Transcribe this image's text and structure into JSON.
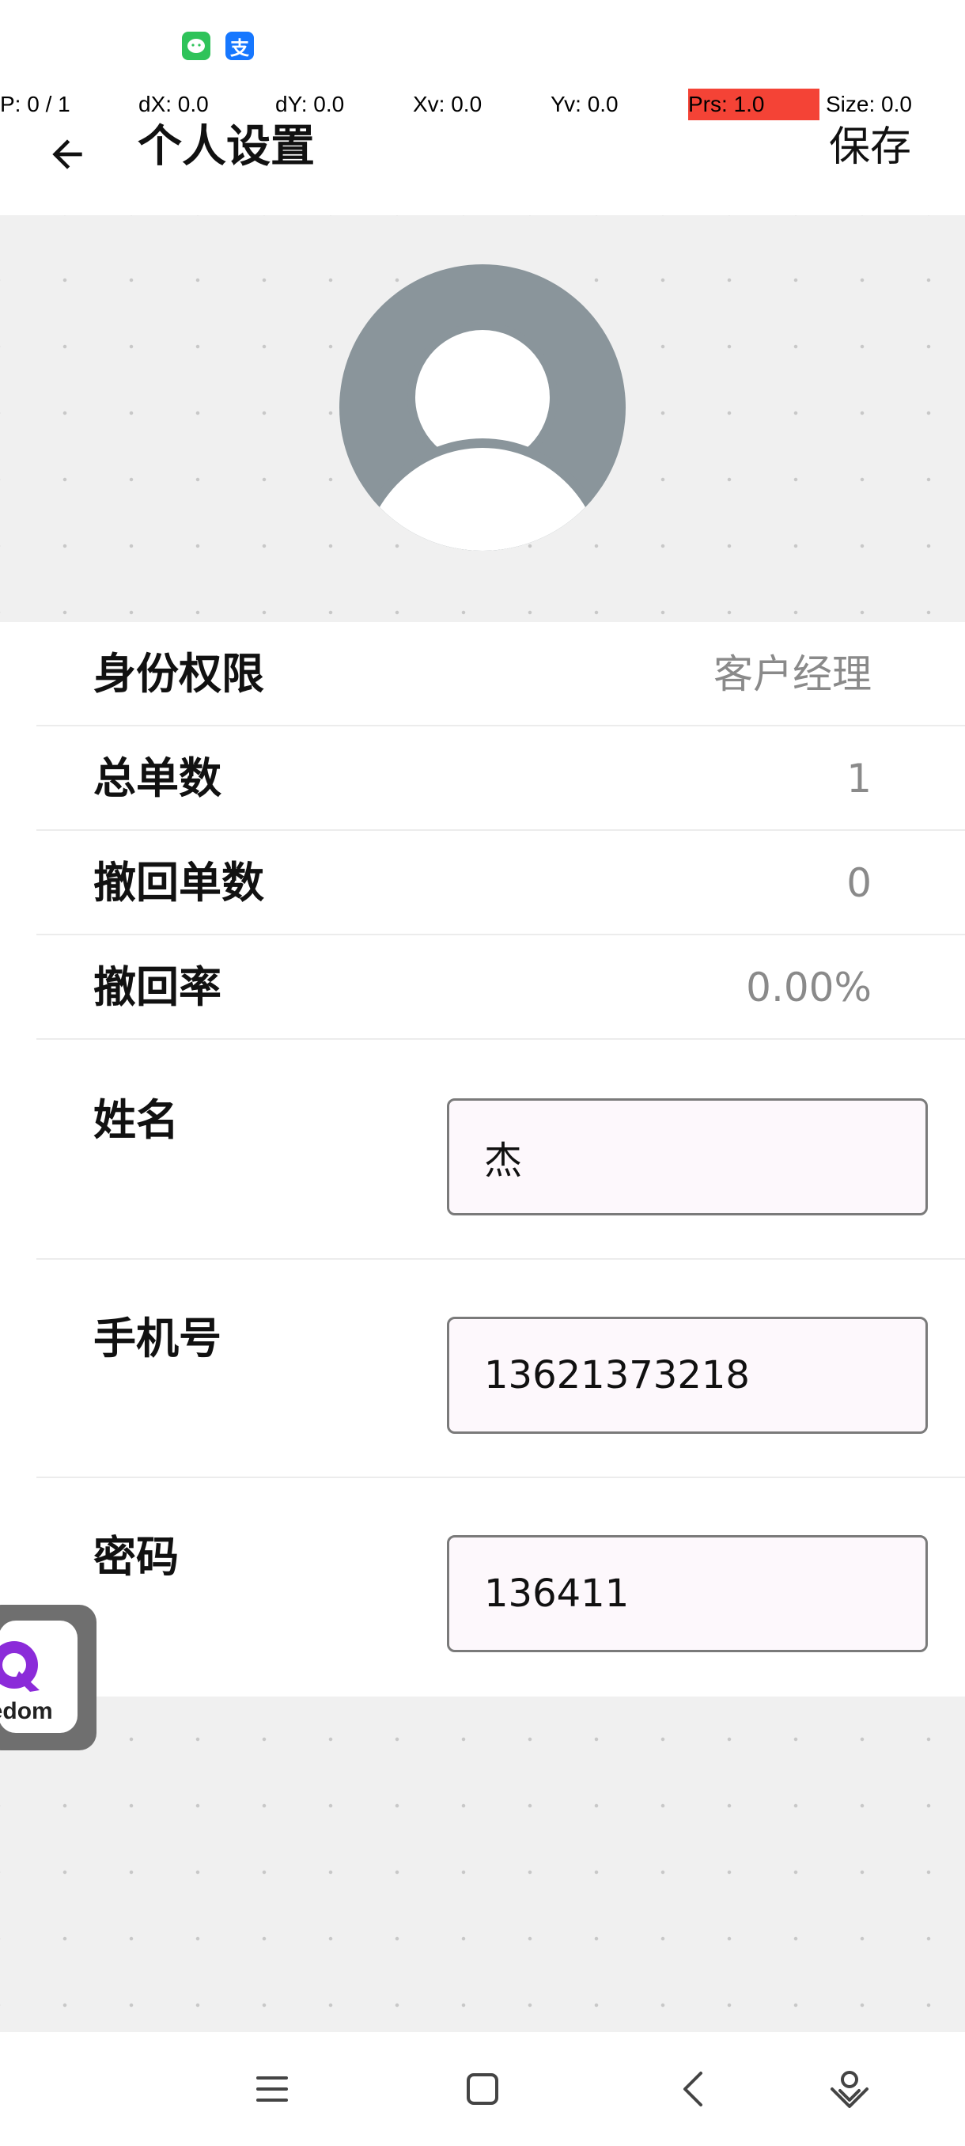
{
  "status_bar": {
    "icons": [
      "wechat-icon",
      "alipay-icon"
    ],
    "alipay_glyph": "支"
  },
  "debug": {
    "p": "P: 0 / 1",
    "dx": "dX: 0.0",
    "dy": "dY: 0.0",
    "xv": "Xv: 0.0",
    "yv": "Yv: 0.0",
    "prs": "Prs: 1.0",
    "size": "Size: 0.0"
  },
  "header": {
    "title": "个人设置",
    "save_label": "保存"
  },
  "info": {
    "role": {
      "label": "身份权限",
      "value": "客户经理"
    },
    "total_orders": {
      "label": "总单数",
      "value": "1"
    },
    "withdrawn_orders": {
      "label": "撤回单数",
      "value": "0"
    },
    "withdraw_rate": {
      "label": "撤回率",
      "value": "0.00%"
    }
  },
  "form": {
    "name": {
      "label": "姓名",
      "value": "杰"
    },
    "phone": {
      "label": "手机号",
      "value": "13621373218"
    },
    "password": {
      "label": "密码",
      "value": "136411"
    }
  },
  "float_app": {
    "word": "eedom"
  },
  "colors": {
    "accent_prs": "#f44336",
    "avatar_gray": "#8a959b",
    "input_bg": "#fdf8fc"
  }
}
